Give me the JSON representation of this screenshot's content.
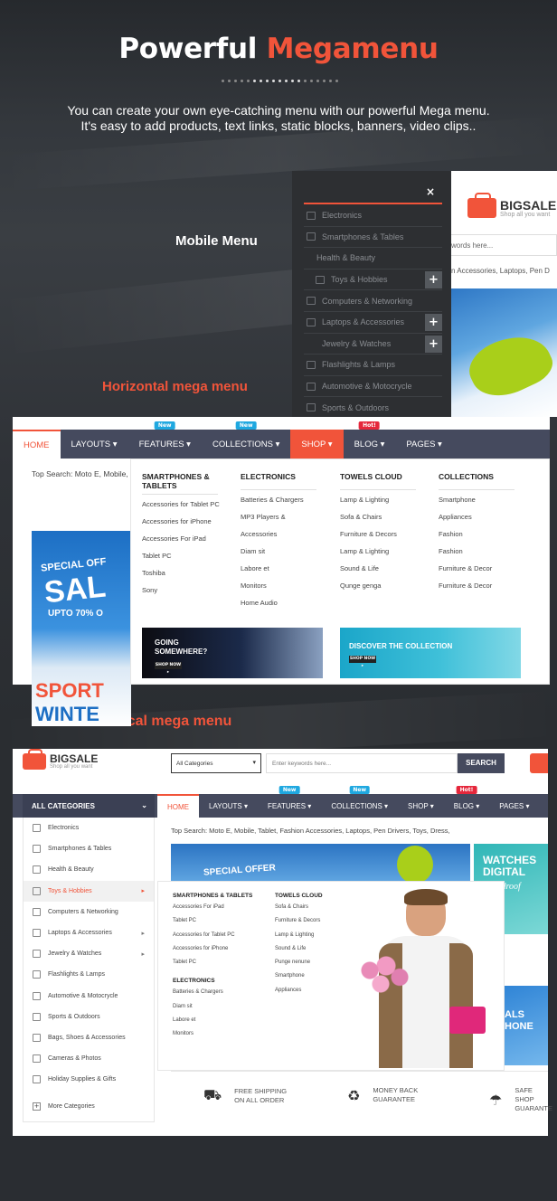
{
  "hero": {
    "title_plain": "Powerful",
    "title_accent": "Megamenu",
    "line1": "You can create your own eye-catching menu with our powerful Mega menu.",
    "line2": "It's easy to add products, text links, static blocks, banners, video clips.."
  },
  "labels": {
    "mobile": "Mobile Menu",
    "horizontal": "Horizontal mega menu",
    "vertical": "Vertical mega menu"
  },
  "colors": {
    "accent": "#f1543a",
    "nav": "#454a5e",
    "badge_new": "#1fa8e0",
    "badge_hot": "#e5273b"
  },
  "mobile_menu": {
    "close_icon": "×",
    "items": [
      {
        "label": "Electronics",
        "icon": "device-icon",
        "plus": false
      },
      {
        "label": "Smartphones & Tables",
        "icon": "phone-icon",
        "plus": false
      },
      {
        "label": "Health & Beauty",
        "icon": "bottle-icon",
        "plus": false
      },
      {
        "label": "Toys & Hobbies",
        "icon": "toy-icon",
        "plus": true
      },
      {
        "label": "Computers & Networking",
        "icon": "monitor-icon",
        "plus": false
      },
      {
        "label": "Laptops & Accessories",
        "icon": "laptop-icon",
        "plus": true
      },
      {
        "label": "Jewelry & Watches",
        "icon": "diamond-icon",
        "plus": true
      },
      {
        "label": "Flashlights & Lamps",
        "icon": "flashlight-icon",
        "plus": false
      },
      {
        "label": "Automotive & Motocrycle",
        "icon": "car-icon",
        "plus": false
      },
      {
        "label": "Sports & Outdoors",
        "icon": "sport-icon",
        "plus": false
      }
    ],
    "plus_label": "+"
  },
  "mobile_shop": {
    "brand": "BIGSALE",
    "tagline": "Shop all you want",
    "search_placeholder": "words here...",
    "top_search": "n Accessories, Laptops, Pen D"
  },
  "horizontal": {
    "nav": [
      {
        "label": "HOME",
        "badge": ""
      },
      {
        "label": "LAYOUTS ▾",
        "badge": ""
      },
      {
        "label": "FEATURES ▾",
        "badge": "New"
      },
      {
        "label": "COLLECTIONS ▾",
        "badge": "New"
      },
      {
        "label": "SHOP ▾",
        "badge": ""
      },
      {
        "label": "BLOG ▾",
        "badge": "Hot!"
      },
      {
        "label": "PAGES ▾",
        "badge": ""
      }
    ],
    "top_search": "Top Search: Moto E, Mobile,",
    "sale": {
      "special": "SPECIAL OFF",
      "big": "SAL",
      "upto": "UPTO 70% O",
      "sport": "SPORT",
      "winter": "WINTE"
    },
    "columns": [
      {
        "title": "SMARTPHONES & TABLETS",
        "items": [
          "Accessories for Tablet PC",
          "Accessories for iPhone",
          "Accessories For iPad",
          "Tablet PC",
          "Toshiba",
          "Sony"
        ]
      },
      {
        "title": "ELECTRONICS",
        "items": [
          "Batteries & Chargers",
          "MP3 Players &",
          "Accessories",
          "Diam sit",
          "Labore et",
          "Monitors",
          "Home Audio"
        ]
      },
      {
        "title": "TOWELS CLOUD",
        "items": [
          "Lamp & Lighting",
          "Sofa & Chairs",
          "Furniture & Decors",
          "Lamp & Lighting",
          "Sound & Life",
          "Qunge genga"
        ]
      },
      {
        "title": "COLLECTIONS",
        "items": [
          "Smartphone",
          "Appliances",
          "Fashion",
          "Fashion",
          "Furniture & Decor",
          "Furniture & Decor"
        ]
      }
    ],
    "banner1": {
      "line1": "GOING",
      "line2": "SOMEWHERE?",
      "button": "SHOP NOW ▸"
    },
    "banner2": {
      "line1": "DISCOVER THE COLLECTION",
      "button": "SHOP NOW ▸"
    }
  },
  "vertical": {
    "brand": "BIGSALE",
    "tagline": "Shop all you want",
    "category_select": "All Categories",
    "search_placeholder": "Enter keywords here...",
    "search_button": "SEARCH",
    "all_categories": "ALL CATEGORIES",
    "nav": [
      {
        "label": "HOME",
        "badge": ""
      },
      {
        "label": "LAYOUTS ▾",
        "badge": ""
      },
      {
        "label": "FEATURES ▾",
        "badge": "New"
      },
      {
        "label": "COLLECTIONS ▾",
        "badge": "New"
      },
      {
        "label": "SHOP ▾",
        "badge": ""
      },
      {
        "label": "BLOG ▾",
        "badge": "Hot!"
      },
      {
        "label": "PAGES ▾",
        "badge": ""
      }
    ],
    "side": [
      {
        "label": "Electronics",
        "arrow": false
      },
      {
        "label": "Smartphones & Tables",
        "arrow": false
      },
      {
        "label": "Health & Beauty",
        "arrow": false
      },
      {
        "label": "Toys & Hobbies",
        "arrow": true,
        "active": true
      },
      {
        "label": "Computers & Networking",
        "arrow": false
      },
      {
        "label": "Laptops & Accessories",
        "arrow": true
      },
      {
        "label": "Jewelry & Watches",
        "arrow": true
      },
      {
        "label": "Flashlights & Lamps",
        "arrow": false
      },
      {
        "label": "Automotive & Motocrycle",
        "arrow": false
      },
      {
        "label": "Sports & Outdoors",
        "arrow": false
      },
      {
        "label": "Bags, Shoes & Accessories",
        "arrow": false
      },
      {
        "label": "Cameras & Photos",
        "arrow": false
      },
      {
        "label": "Holiday Supplies & Gifts",
        "arrow": false
      }
    ],
    "more": "More Categories",
    "top_search": "Top Search: Moto E, Mobile, Tablet, Fashion Accessories, Laptops, Pen Drivers, Toys, Dress,",
    "banner_special": "SPECIAL OFFER",
    "watches": {
      "line1": "WATCHES",
      "line2": "DIGITAL",
      "line3": "ardroof"
    },
    "phone": {
      "line1": "ALS",
      "line2": "HONE"
    },
    "drop_col1": {
      "title": "SMARTPHONES & TABLETS",
      "items": [
        "Accessories For iPad",
        "Tablet PC",
        "Accessories for Tablet PC",
        "Accessories for iPhone",
        "Tablet PC"
      ],
      "title2": "ELECTRONICS",
      "items2": [
        "Batteries & Chargers",
        "Diam sit",
        "Labore et",
        "Monitors"
      ]
    },
    "drop_col2": {
      "title": "TOWELS CLOUD",
      "items": [
        "Sofa & Chairs",
        "Furniture & Decors",
        "Lamp & Lighting",
        "Sound & Life",
        "Punge nenune",
        "Smartphone",
        "Appliances"
      ]
    },
    "features": [
      {
        "line1": "FREE SHIPPING",
        "line2": "ON ALL ORDER",
        "icon": "truck-icon"
      },
      {
        "line1": "MONEY BACK",
        "line2": "GUARANTEE",
        "icon": "recycle-icon"
      },
      {
        "line1": "SAFE SHOP",
        "line2": "GUARANTE",
        "icon": "umbrella-icon"
      }
    ]
  }
}
